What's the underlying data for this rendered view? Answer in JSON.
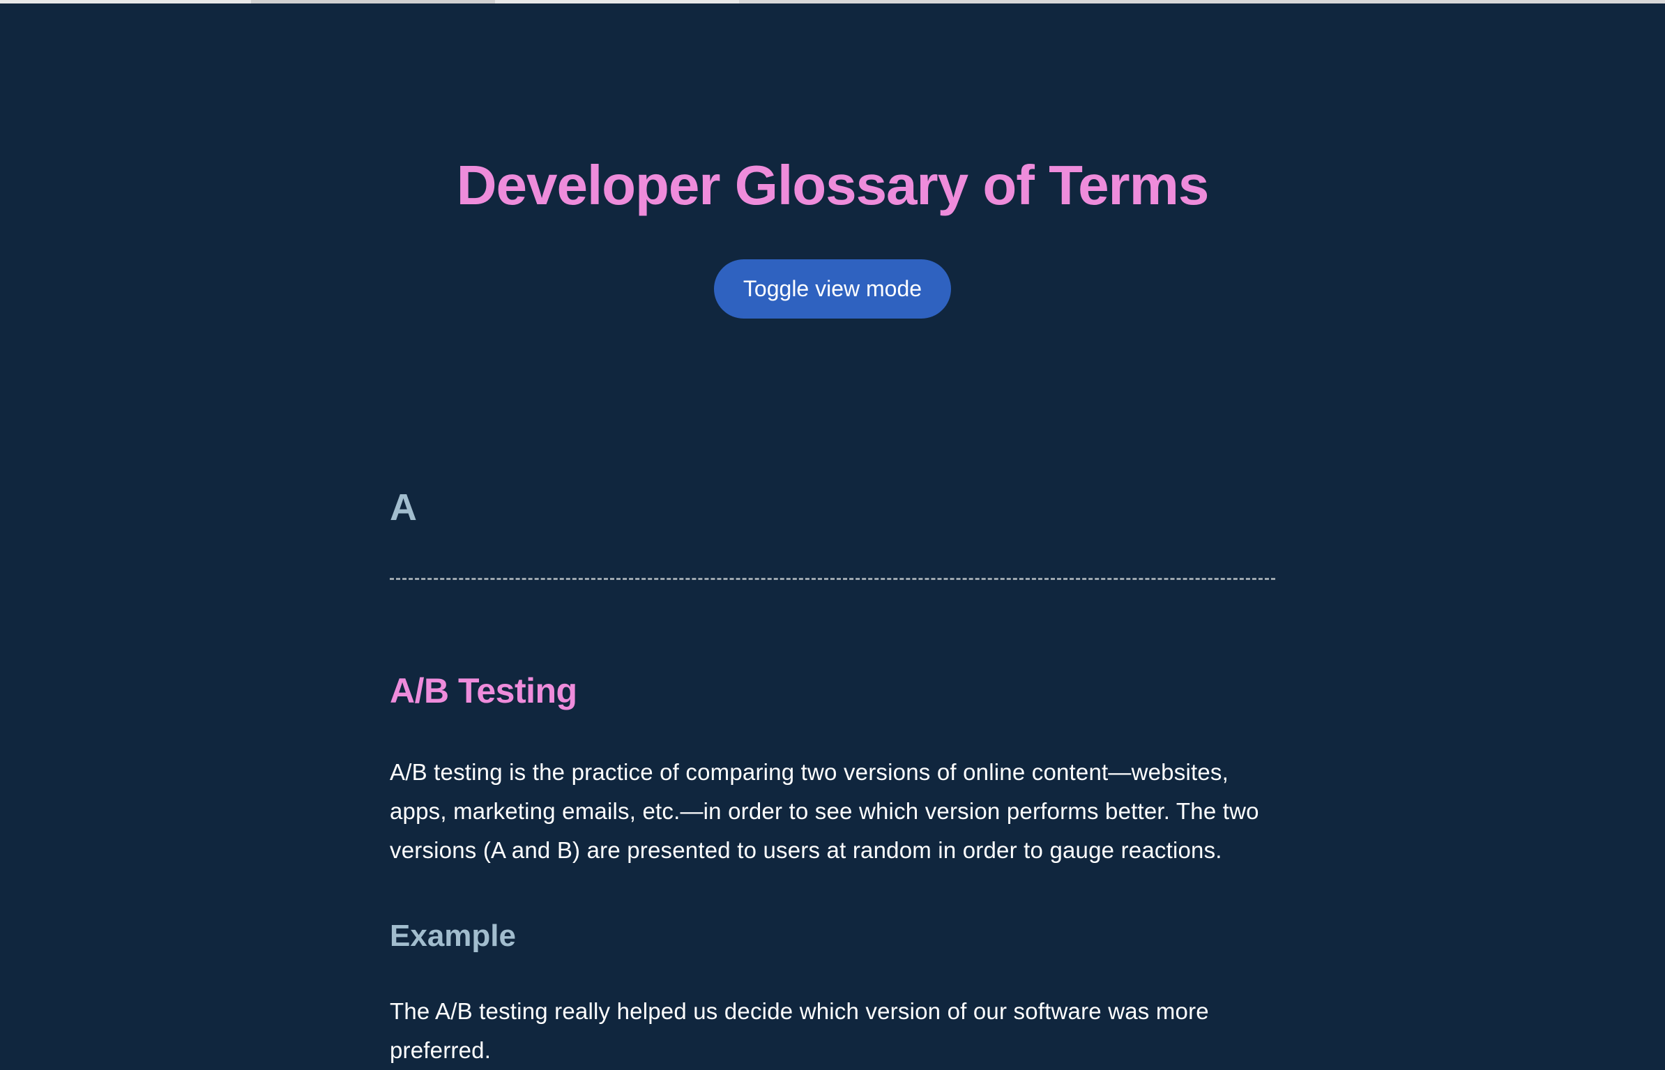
{
  "header": {
    "title": "Developer Glossary of Terms",
    "toggle_button_label": "Toggle view mode"
  },
  "sections": [
    {
      "letter": "A",
      "terms": [
        {
          "name": "A/B Testing",
          "description": "A/B testing is the practice of comparing two versions of online content—websites, apps, marketing emails, etc.—in order to see which version performs better. The two versions (A and B) are presented to users at random in order to gauge reactions.",
          "example_heading": "Example",
          "example_text": "The A/B testing really helped us decide which version of our software was more preferred."
        }
      ]
    }
  ]
}
